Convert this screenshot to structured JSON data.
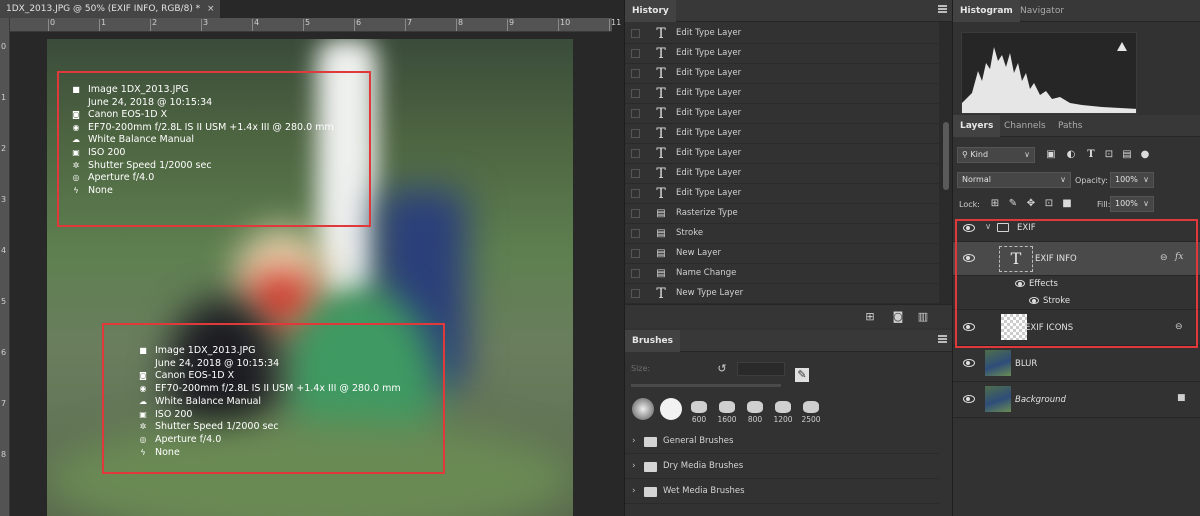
{
  "document": {
    "tab_title": "1DX_2013.JPG @ 50% (EXIF INFO, RGB/8) *",
    "close_glyph": "×",
    "ruler_h_ticks": [
      "0",
      "1",
      "2",
      "3",
      "4",
      "5",
      "6",
      "7",
      "8",
      "9",
      "10",
      "11"
    ],
    "ruler_v_ticks": [
      "0",
      "1",
      "2",
      "3",
      "4",
      "5",
      "6",
      "7",
      "8"
    ],
    "exif_top": [
      {
        "icon": "document-icon",
        "glyph": "■",
        "text": "Image  1DX_2013.JPG"
      },
      {
        "icon": "",
        "glyph": "",
        "text": "June 24, 2018 @ 10:15:34"
      },
      {
        "icon": "camera-icon",
        "glyph": "◙",
        "text": "Canon EOS-1D X"
      },
      {
        "icon": "eye-lens-icon",
        "glyph": "◉",
        "text": "EF70-200mm f/2.8L IS II USM +1.4x III @ 280.0 mm"
      },
      {
        "icon": "white-balance-icon",
        "glyph": "☁",
        "text": "White Balance Manual"
      },
      {
        "icon": "iso-icon",
        "glyph": "▣",
        "text": "ISO 200"
      },
      {
        "icon": "shutter-icon",
        "glyph": "✲",
        "text": "Shutter Speed 1/2000 sec"
      },
      {
        "icon": "aperture-icon",
        "glyph": "◎",
        "text": "Aperture f/4.0"
      },
      {
        "icon": "flash-icon",
        "glyph": "ϟ",
        "text": "None"
      }
    ],
    "exif_bottom": [
      {
        "icon": "document-icon",
        "glyph": "■",
        "text": "Image  1DX_2013.JPG"
      },
      {
        "icon": "",
        "glyph": "",
        "text": "June 24, 2018 @ 10:15:34"
      },
      {
        "icon": "camera-icon",
        "glyph": "◙",
        "text": "Canon EOS-1D X"
      },
      {
        "icon": "eye-lens-icon",
        "glyph": "◉",
        "text": "EF70-200mm f/2.8L IS II USM +1.4x III @ 280.0 mm"
      },
      {
        "icon": "white-balance-icon",
        "glyph": "☁",
        "text": "White Balance Manual"
      },
      {
        "icon": "iso-icon",
        "glyph": "▣",
        "text": "ISO 200"
      },
      {
        "icon": "shutter-icon",
        "glyph": "✲",
        "text": "Shutter Speed 1/2000 sec"
      },
      {
        "icon": "aperture-icon",
        "glyph": "◎",
        "text": "Aperture f/4.0"
      },
      {
        "icon": "flash-icon",
        "glyph": "ϟ",
        "text": "None"
      }
    ]
  },
  "history": {
    "tab": "History",
    "items": [
      {
        "icon": "type",
        "label": "Edit Type Layer"
      },
      {
        "icon": "type",
        "label": "Edit Type Layer"
      },
      {
        "icon": "type",
        "label": "Edit Type Layer"
      },
      {
        "icon": "type",
        "label": "Edit Type Layer"
      },
      {
        "icon": "type",
        "label": "Edit Type Layer"
      },
      {
        "icon": "type",
        "label": "Edit Type Layer"
      },
      {
        "icon": "type",
        "label": "Edit Type Layer"
      },
      {
        "icon": "type",
        "label": "Edit Type Layer"
      },
      {
        "icon": "type",
        "label": "Edit Type Layer"
      },
      {
        "icon": "doc",
        "label": "Rasterize Type"
      },
      {
        "icon": "doc",
        "label": "Stroke"
      },
      {
        "icon": "doc",
        "label": "New Layer"
      },
      {
        "icon": "doc",
        "label": "Name Change"
      },
      {
        "icon": "type",
        "label": "New Type Layer"
      }
    ]
  },
  "brushes": {
    "tab": "Brushes",
    "size_label": "Size:",
    "tips": [
      "",
      "",
      "600",
      "1600",
      "800",
      "1200",
      "2500"
    ],
    "groups": [
      "General Brushes",
      "Dry Media Brushes",
      "Wet Media Brushes"
    ]
  },
  "right": {
    "tabs": [
      "Histogram",
      "Navigator"
    ],
    "layer_tabs": [
      "Layers",
      "Channels",
      "Paths"
    ],
    "kind_label": "Kind",
    "blend_mode": "Normal",
    "opacity_label": "Opacity:",
    "opacity_value": "100%",
    "lock_label": "Lock:",
    "fill_label": "Fill:",
    "fill_value": "100%",
    "layers": {
      "group": "EXIF",
      "exif_info": "EXIF INFO",
      "effects": "Effects",
      "stroke": "Stroke",
      "exif_icons": "EXIF ICONS",
      "blur": "BLUR",
      "background": "Background",
      "fx": "fx"
    }
  },
  "colors": {
    "red_box": "#e0393b",
    "blue_box": "#3f6fd6",
    "panel": "#323232"
  }
}
